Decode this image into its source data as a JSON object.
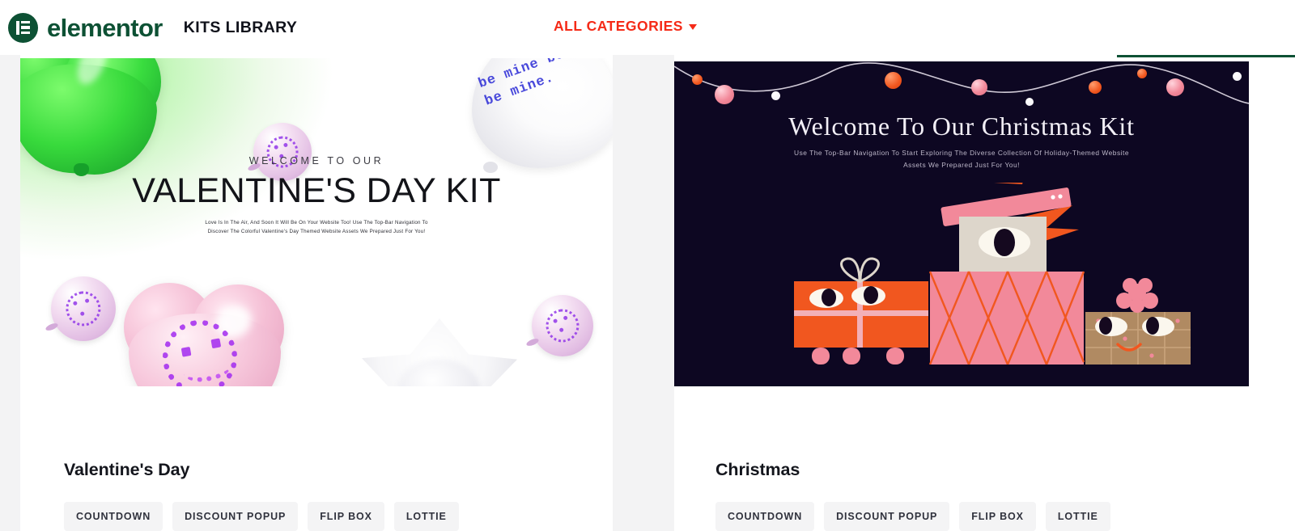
{
  "header": {
    "brand_name": "elementor",
    "brand_icon": "elementor-logo-icon",
    "section_title": "KITS LIBRARY",
    "categories_label": "ALL CATEGORIES",
    "categories_caret_icon": "chevron-down-icon",
    "accent_color": "#f52a17",
    "brand_color": "#0d5134"
  },
  "cards": [
    {
      "title": "Valentine's Day",
      "thumbnail": {
        "theme": "valentines",
        "background_color": "#ffffff",
        "accent_color": "#37d83c",
        "eyebrow": "WELCOME TO OUR",
        "headline": "VALENTINE'S DAY KIT",
        "subtext": "Love Is In The Air, And Soon It Will Be On Your Website Too! Use The Top-Bar Navigation To Discover The Colorful Valentine's Day Themed Website Assets We Prepared Just For You!",
        "balloon_text": "be mine\nbe mine\nbe mine."
      },
      "tags": [
        "COUNTDOWN",
        "DISCOUNT POPUP",
        "FLIP BOX",
        "LOTTIE"
      ]
    },
    {
      "title": "Christmas",
      "thumbnail": {
        "theme": "christmas",
        "background_color": "#0d0722",
        "accent_color": "#f1571f",
        "headline": "Welcome To Our Christmas Kit",
        "subtext": "Use The Top-Bar Navigation To Start Exploring The Diverse Collection Of Holiday-Themed Website Assets We Prepared Just For You!",
        "lights": [
          {
            "color": "#f1571f",
            "size": 13
          },
          {
            "color": "#f2899a",
            "size": 24
          },
          {
            "color": "#ffffff",
            "size": 11
          },
          {
            "color": "#f1571f",
            "size": 21
          },
          {
            "color": "#f2899a",
            "size": 20
          },
          {
            "color": "#ffffff",
            "size": 10
          },
          {
            "color": "#f1571f",
            "size": 16
          },
          {
            "color": "#f1571f",
            "size": 12
          },
          {
            "color": "#f2899a",
            "size": 22
          },
          {
            "color": "#ffffff",
            "size": 11
          }
        ]
      },
      "tags": [
        "COUNTDOWN",
        "DISCOUNT POPUP",
        "FLIP BOX",
        "LOTTIE"
      ]
    }
  ],
  "page": {
    "background_color": "#f3f3f4",
    "hover_indicator_color": "#0d5134"
  }
}
